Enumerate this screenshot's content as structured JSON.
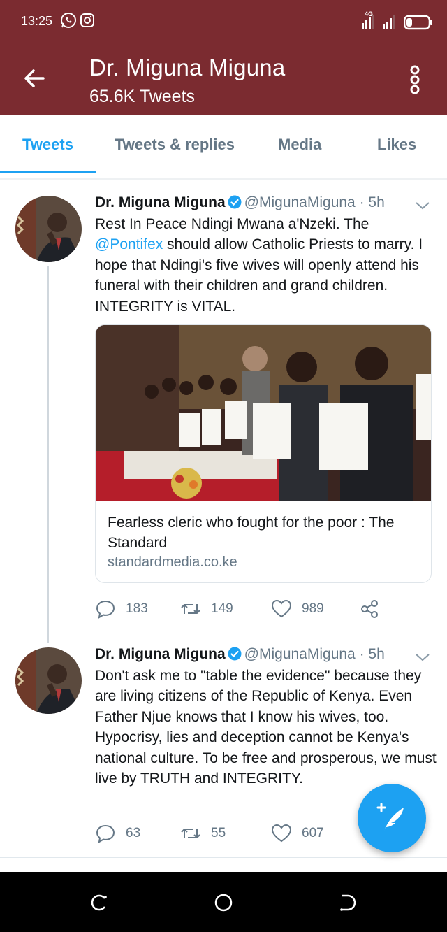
{
  "status_bar": {
    "time": "13:25",
    "network": "4G",
    "icons": [
      "whatsapp-icon",
      "instagram-icon",
      "signal-icon",
      "battery-icon"
    ]
  },
  "header": {
    "title": "Dr. Miguna Miguna",
    "subtitle": "65.6K Tweets",
    "background": "#7b2b30"
  },
  "tabs": [
    {
      "label": "Tweets",
      "active": true
    },
    {
      "label": "Tweets & replies",
      "active": false
    },
    {
      "label": "Media",
      "active": false
    },
    {
      "label": "Likes",
      "active": false
    }
  ],
  "accent_color": "#1da1f2",
  "tweets": [
    {
      "name": "Dr. Miguna Miguna",
      "handle": "@MigunaMiguna",
      "time": " · 5h",
      "text_before_mention": "Rest In Peace Ndingi Mwana a'Nzeki. The ",
      "mention": "@Pontifex",
      "text_after_mention": " should allow Catholic Priests to marry. I hope that Ndingi's five wives will openly attend his funeral with their children and grand children. INTEGRITY is VITAL.",
      "card": {
        "title": "Fearless cleric who fought for the poor : The Standard",
        "domain": "standardmedia.co.ke"
      },
      "replies": "183",
      "retweets": "149",
      "likes": "989"
    },
    {
      "name": "Dr. Miguna Miguna",
      "handle": "@MigunaMiguna",
      "time": " · 5h",
      "text": "Don't ask me to \"table the evidence\" because they are living citizens of the Republic of Kenya. Even Father Njue knows that I know his wives, too. Hypocrisy, lies and deception cannot be Kenya's national culture. To be free and prosperous, we must live by TRUTH and INTEGRITY.",
      "replies": "63",
      "retweets": "55",
      "likes": "607"
    }
  ]
}
